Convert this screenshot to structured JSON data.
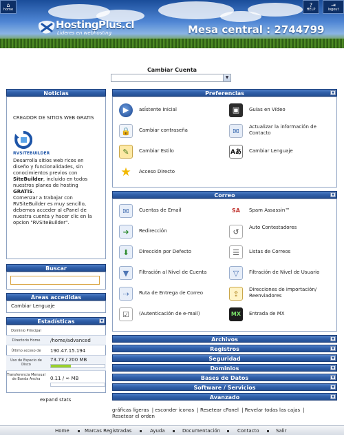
{
  "header": {
    "home_label": "home",
    "help_label": "HELP",
    "logout_label": "logout",
    "logo_name": "HostingPlus.cl",
    "logo_tagline": "Lideres en webhosting",
    "phone": "Mesa central : 2744799"
  },
  "account": {
    "label": "Cambiar Cuenta",
    "selected": ""
  },
  "news": {
    "title": "Noticias",
    "heading": "CREADOR DE SITIOS WEB GRATIS",
    "logo_text": "RVSITEBUILDER",
    "p1_prefix": "Desarrolla sitios web ricos en diseño y funcionalidades, sin conocimientos previos con ",
    "p1_bold": "SiteBuilder",
    "p1_suffix": ", incluido en todos nuestros planes de hosting ",
    "p1_bold2": "GRATIS",
    "p1_end": ".",
    "p2": "Comenzar a trabajar con RVSiteBuilder es muy sencillo, debemos acceder al cPanel de nuestra cuenta y hacer clic en la opcion \"RVSiteBuilder\"."
  },
  "search": {
    "title": "Buscar",
    "value": ""
  },
  "frequent": {
    "title": "Áreas accedidas frecuentemente",
    "item": "Cambiar Lenguaje"
  },
  "stats": {
    "title": "Estadísticas",
    "rows": [
      {
        "key": "Dominio Principal",
        "value": ""
      },
      {
        "key": "Directorio Home",
        "value": "/home/advanced"
      },
      {
        "key": "Último acceso de",
        "value": "190.47.15.194"
      },
      {
        "key": "Uso de Espacio de Disco",
        "value": "73.73 / 200 MB"
      },
      {
        "key": "Transferencia Mensual de Banda Ancha",
        "value": "0.11 / ∞ MB"
      }
    ],
    "disk_fraction": 0.37,
    "bandwidth_fraction": 0.0,
    "expand_label": "expand stats"
  },
  "preferences": {
    "title": "Preferencias",
    "items": [
      {
        "label": "asÍstente Inicial",
        "icon": "play-icon"
      },
      {
        "label": "Guías en Vídeo",
        "icon": "video-icon"
      },
      {
        "label": "Cambiar contraseña",
        "icon": "lock-icon"
      },
      {
        "label": "Actualizar la información de Contacto",
        "icon": "contact-icon"
      },
      {
        "label": "Cambiar Estilo",
        "icon": "style-icon"
      },
      {
        "label": "Cambiar Lenguaje",
        "icon": "language-icon"
      },
      {
        "label": "Acceso Directo",
        "icon": "star-icon"
      }
    ]
  },
  "mail": {
    "title": "Correo",
    "items": [
      {
        "label": "Cuentas de Email",
        "icon": "mail-icon"
      },
      {
        "label": "Spam Assassin™",
        "icon": "spam-assassin-icon"
      },
      {
        "label": "Redirección",
        "icon": "forward-mail-icon"
      },
      {
        "label": "Auto Contestadores",
        "icon": "autoresponder-icon"
      },
      {
        "label": "Dirección por Defecto",
        "icon": "default-address-icon"
      },
      {
        "label": "Listas de Correos",
        "icon": "mailing-list-icon"
      },
      {
        "label": "Filtración al Nivel de Cuenta",
        "icon": "account-filter-icon"
      },
      {
        "label": "Filtración de Nivel de Usuario",
        "icon": "user-filter-icon"
      },
      {
        "label": "Ruta de Entrega de Correo",
        "icon": "delivery-route-icon"
      },
      {
        "label": "Direcciones de importación/ Reenviadores",
        "icon": "import-icon"
      },
      {
        "label": "(Autenticación de e-mail)",
        "icon": "authentication-icon"
      },
      {
        "label": "Entrada de MX",
        "icon": "mx-icon"
      }
    ]
  },
  "collapsed_sections": [
    "Archivos",
    "Registros",
    "Seguridad",
    "Dominios",
    "Bases de Datos",
    "Software / Servicios",
    "Avanzado"
  ],
  "tools": {
    "graphics_light": "gráficas ligeras",
    "hide_icons": "esconder iconos",
    "reset_cpanel": "Resetear cPanel",
    "reveal_boxes": "Revelar todas las cajas",
    "reset_order": "Resetear el orden"
  },
  "footer": [
    "Home",
    "Marcas Registradas",
    "Ayuda",
    "Documentación",
    "Contacto",
    "Salir"
  ],
  "colors": {
    "bar_blue": "#2f5ea8",
    "disk_meter": "#9ad12b"
  }
}
